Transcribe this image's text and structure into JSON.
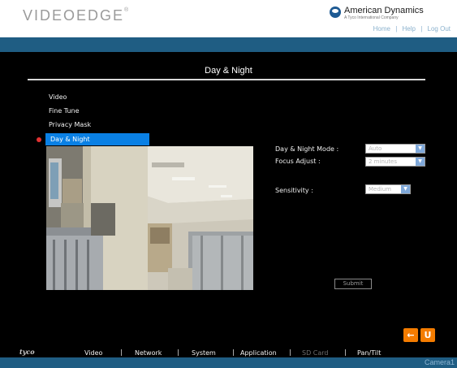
{
  "header": {
    "logo": "VIDEOEDGE",
    "brand_name": "American Dynamics",
    "brand_sub": "A Tyco International Company",
    "links": [
      "Home",
      "|",
      "Help",
      "|",
      "Log Out"
    ]
  },
  "page": {
    "title": "Day & Night"
  },
  "side_menu": {
    "items": [
      "Video",
      "Fine Tune",
      "Privacy Mask",
      "Day & Night"
    ],
    "active": "Day & Night"
  },
  "form": {
    "day_night_mode": {
      "label": "Day & Night Mode :",
      "value": "Auto"
    },
    "focus_adjust": {
      "label": "Focus Adjust :",
      "value": "2 minutes"
    },
    "sensitivity": {
      "label": "Sensitivity :",
      "value": "Medium"
    },
    "submit_label": "Submit"
  },
  "controls": {
    "back_glyph": "←",
    "undo_glyph": "U",
    "accent": "#f47c00"
  },
  "bottom_nav": {
    "brand": "tyco",
    "items": [
      "Video",
      "Network",
      "System",
      "Application",
      "SD Card",
      "Pan/Tilt"
    ],
    "disabled": [
      "SD Card"
    ]
  },
  "footer": {
    "camera": "Camera1"
  },
  "colors": {
    "bar": "#1f5d83",
    "active_menu": "#0a80e4"
  }
}
